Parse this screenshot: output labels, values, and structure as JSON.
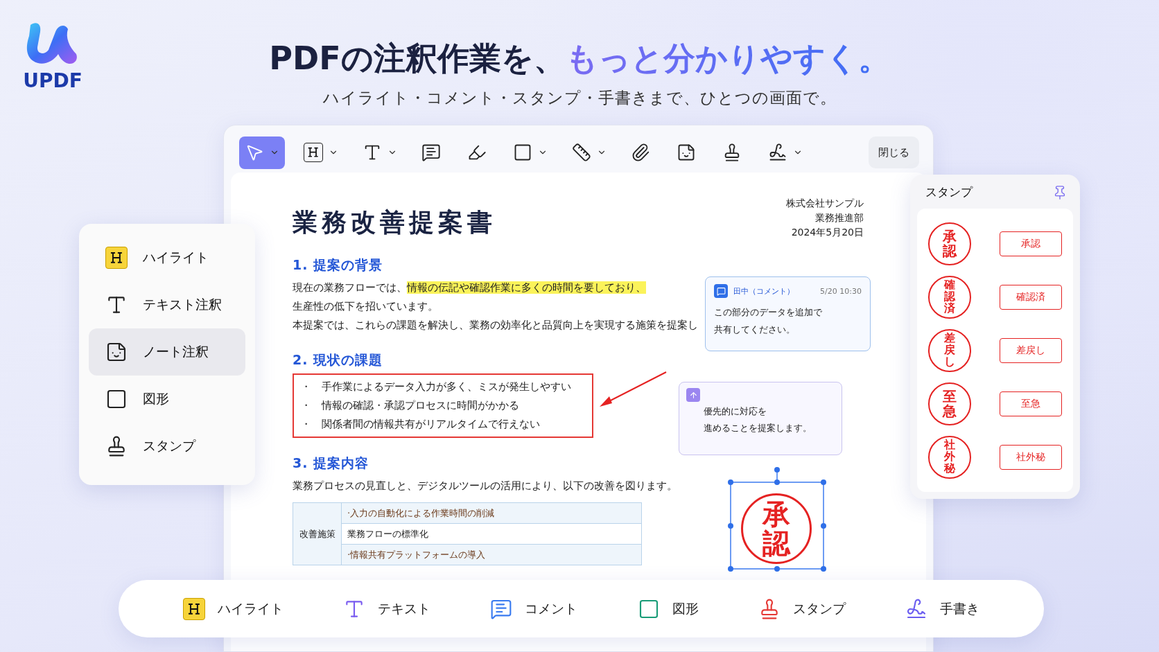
{
  "logo": {
    "text": "UPDF"
  },
  "headline": {
    "text": "PDFの注釈作業を、",
    "accent": "もっと分かりやすく。"
  },
  "subtitle": "ハイライト・コメント・スタンプ・手書きまで、ひとつの画面で。",
  "toolbar": {
    "tools": [
      {
        "kind": "select",
        "selected": true,
        "dropdown": true
      },
      {
        "kind": "highlight",
        "selected": false,
        "dropdown": true
      },
      {
        "kind": "text",
        "selected": false,
        "dropdown": true
      },
      {
        "kind": "comment",
        "selected": false,
        "dropdown": false
      },
      {
        "kind": "pencil",
        "selected": false,
        "dropdown": false
      },
      {
        "kind": "shape",
        "selected": false,
        "dropdown": true
      },
      {
        "kind": "textbox",
        "selected": false,
        "dropdown": true
      },
      {
        "kind": "attach",
        "selected": false,
        "dropdown": false
      },
      {
        "kind": "note",
        "selected": false,
        "dropdown": false
      },
      {
        "kind": "stamp",
        "selected": false,
        "dropdown": false
      },
      {
        "kind": "signature",
        "selected": false,
        "dropdown": true
      }
    ],
    "close": "閉じる"
  },
  "document": {
    "title": "業務改善提案書",
    "issuer": [
      "株式会社サンプル",
      "業務推進部",
      "2024年5月20日"
    ],
    "sections": [
      {
        "heading": "1. 提案の背景",
        "kind": "paragraph",
        "lines": [
          {
            "text": "現在の業務フローでは、",
            "highlight": "情報の伝記や確認作業に多くの時間を要しており、"
          },
          {
            "text": "生産性の低下を招いています。"
          },
          {
            "text": "本提案では、これらの課題を解決し、業務の効率化と品質向上を実現する施策を提案し"
          }
        ]
      },
      {
        "heading": "2. 現状の課題",
        "kind": "boxed_list",
        "items": [
          "・　手作業によるデータ入力が多く、ミスが発生しやすい",
          "・　情報の確認・承認プロセスに時間がかかる",
          "・　関係者間の情報共有がリアルタイムで行えない"
        ]
      },
      {
        "heading": "3. 提案内容",
        "kind": "table",
        "lines": [
          {
            "text": "業務プロセスの見直しと、デジタルツールの活用により、以下の改善を図ります。"
          }
        ],
        "table": {
          "row_header": "改善施策",
          "rows": [
            {
              "text": "·入力の自動化による作業時間の削減",
              "shaded": true
            },
            {
              "text": "業務フローの標準化",
              "shaded": false
            },
            {
              "text": "·情報共有プラットフォームの導入",
              "shaded": true
            }
          ]
        }
      }
    ],
    "comment": {
      "author": "田中（コメント）",
      "time": "5/20 10:30",
      "lines": [
        "この部分のデータを追加で",
        "共有してください。"
      ]
    },
    "note": {
      "lines": [
        "優先的に対応を",
        "進めることを提案します。"
      ]
    },
    "placed_stamp": {
      "seal": "承認"
    }
  },
  "annotation_menu": {
    "items": [
      {
        "kind": "highlight",
        "label": "ハイライト",
        "selected": false
      },
      {
        "kind": "text",
        "label": "テキスト注釈",
        "selected": false
      },
      {
        "kind": "note",
        "label": "ノート注釈",
        "selected": true
      },
      {
        "kind": "shape",
        "label": "図形",
        "selected": false
      },
      {
        "kind": "stamp",
        "label": "スタンプ",
        "selected": false
      }
    ]
  },
  "stamp_panel": {
    "title": "スタンプ",
    "stamps": [
      {
        "seal": "承認",
        "label": "承認"
      },
      {
        "seal": "確認済",
        "label": "確認済"
      },
      {
        "seal": "差戻し",
        "label": "差戻し"
      },
      {
        "seal": "至急",
        "label": "至急"
      },
      {
        "seal": "社外秘",
        "label": "社外秘"
      }
    ]
  },
  "feature_bar": {
    "items": [
      {
        "kind": "highlight",
        "label": "ハイライト",
        "color": "#f7d43a"
      },
      {
        "kind": "text",
        "label": "テキスト",
        "color": "#7a5cf0"
      },
      {
        "kind": "comment",
        "label": "コメント",
        "color": "#3a7bf0"
      },
      {
        "kind": "shape",
        "label": "図形",
        "color": "#1a9c78"
      },
      {
        "kind": "stamp",
        "label": "スタンプ",
        "color": "#e53935"
      },
      {
        "kind": "signature",
        "label": "手書き",
        "color": "#6a5cf0"
      }
    ]
  }
}
